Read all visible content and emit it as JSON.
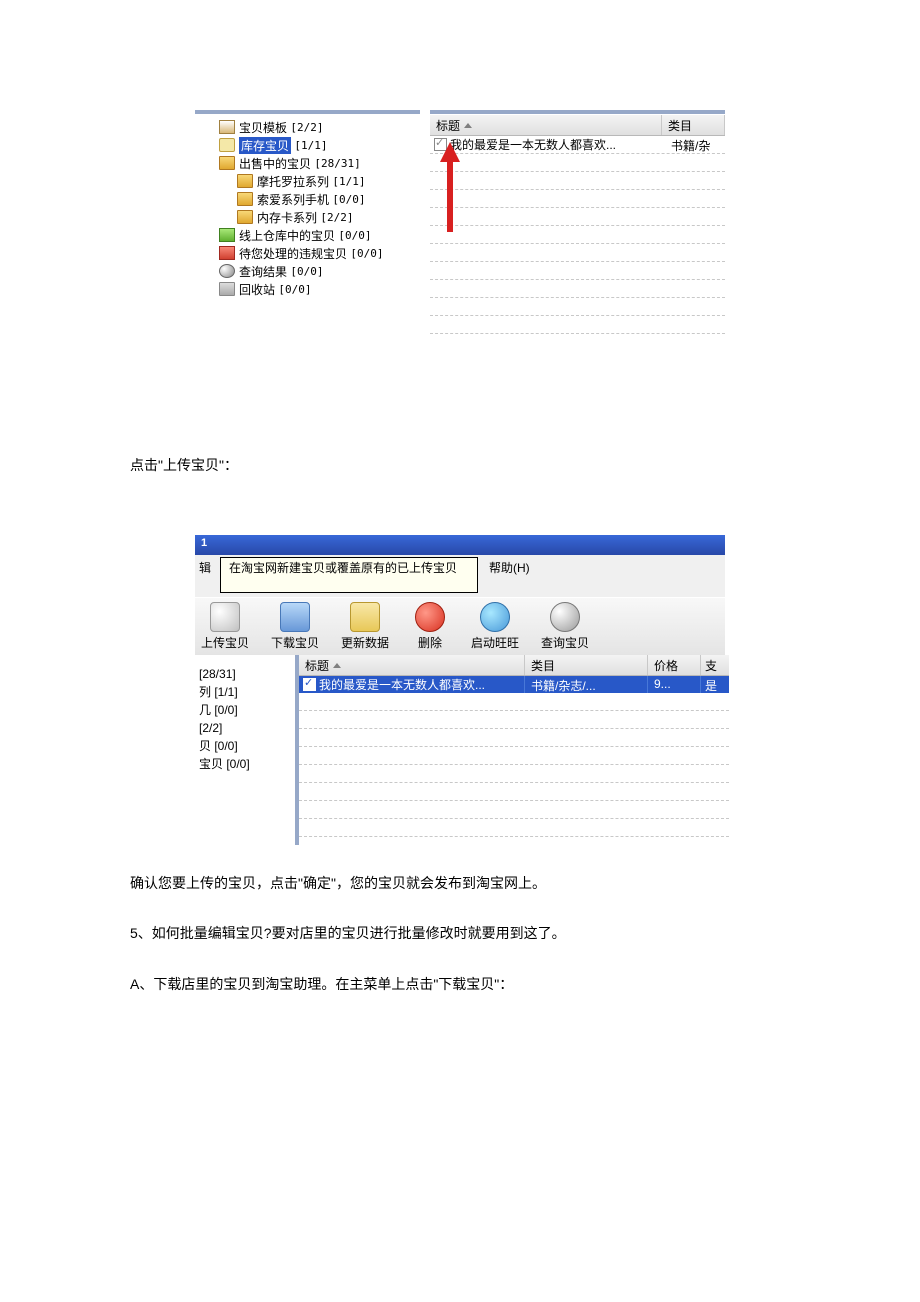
{
  "fig1": {
    "tree": [
      {
        "icon": "box",
        "label": "宝贝模板",
        "count": "[2/2]",
        "level": 1
      },
      {
        "icon": "lock",
        "label": "库存宝贝",
        "count": "[1/1]",
        "level": 1,
        "selected": true
      },
      {
        "icon": "fold",
        "label": "出售中的宝贝",
        "count": "[28/31]",
        "level": 1
      },
      {
        "icon": "fold",
        "label": "摩托罗拉系列",
        "count": "[1/1]",
        "level": 2
      },
      {
        "icon": "fold",
        "label": "索爱系列手机",
        "count": "[0/0]",
        "level": 2
      },
      {
        "icon": "fold",
        "label": "内存卡系列",
        "count": "[2/2]",
        "level": 2
      },
      {
        "icon": "foldg",
        "label": "线上仓库中的宝贝",
        "count": "[0/0]",
        "level": 1
      },
      {
        "icon": "foldr",
        "label": "待您处理的违规宝贝",
        "count": "[0/0]",
        "level": 1
      },
      {
        "icon": "mag",
        "label": "查询结果",
        "count": "[0/0]",
        "level": 1
      },
      {
        "icon": "bin",
        "label": "回收站",
        "count": "[0/0]",
        "level": 1
      }
    ],
    "headers": {
      "title": "标题",
      "category": "类目"
    },
    "row": {
      "title": "我的最爱是一本无数人都喜欢...",
      "category": "书籍/杂"
    }
  },
  "text1": "点击\"上传宝贝\"：",
  "fig2": {
    "titlebar": "1",
    "menu_partial": "辑",
    "tooltip": "在淘宝网新建宝贝或覆盖原有的已上传宝贝",
    "help": "帮助(H)",
    "toolbar": [
      {
        "label": "上传宝贝"
      },
      {
        "label": "下载宝贝"
      },
      {
        "label": "更新数据"
      },
      {
        "label": "删除"
      },
      {
        "label": "启动旺旺"
      },
      {
        "label": "查询宝贝"
      }
    ],
    "side": [
      "[28/31]",
      "列 [1/1]",
      "几 [0/0]",
      "[2/2]",
      "贝 [0/0]",
      "宝贝 [0/0]"
    ],
    "headers": {
      "title": "标题",
      "category": "类目",
      "price": "价格",
      "pay": "支"
    },
    "row": {
      "title": "我的最爱是一本无数人都喜欢...",
      "category": "书籍/杂志/...",
      "price": "9...",
      "pay": "是"
    }
  },
  "para": [
    "确认您要上传的宝贝，点击\"确定\"，您的宝贝就会发布到淘宝网上。",
    "5、如何批量编辑宝贝?要对店里的宝贝进行批量修改时就要用到这了。",
    "A、下载店里的宝贝到淘宝助理。在主菜单上点击\"下载宝贝\"："
  ]
}
